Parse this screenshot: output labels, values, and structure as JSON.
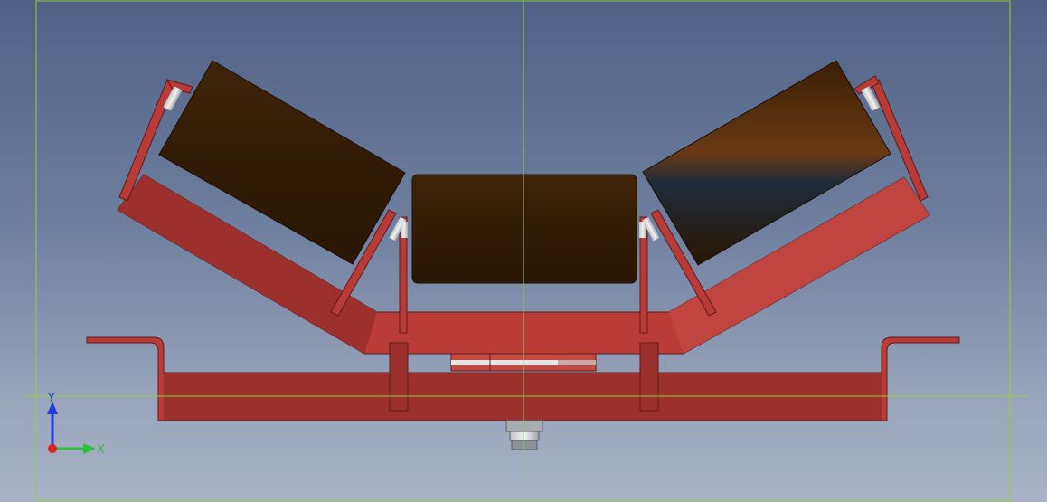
{
  "viewer": {
    "background_top": "#4f6185",
    "background_bottom": "#a9b2c6",
    "frame_color": "#8fd13c",
    "crosshair_color": "#8fd13c"
  },
  "model": {
    "description_icon": "troughing-idler-assembly",
    "frame_color": "#b83b37",
    "frame_dark": "#8c2b29",
    "roller_color": "#3a2008",
    "roller_count": 3
  },
  "triad": {
    "y_label": "Y",
    "x_label": "X",
    "y_color": "#1f3de0",
    "x_color": "#2fbf3a",
    "origin_color": "#e02020"
  }
}
